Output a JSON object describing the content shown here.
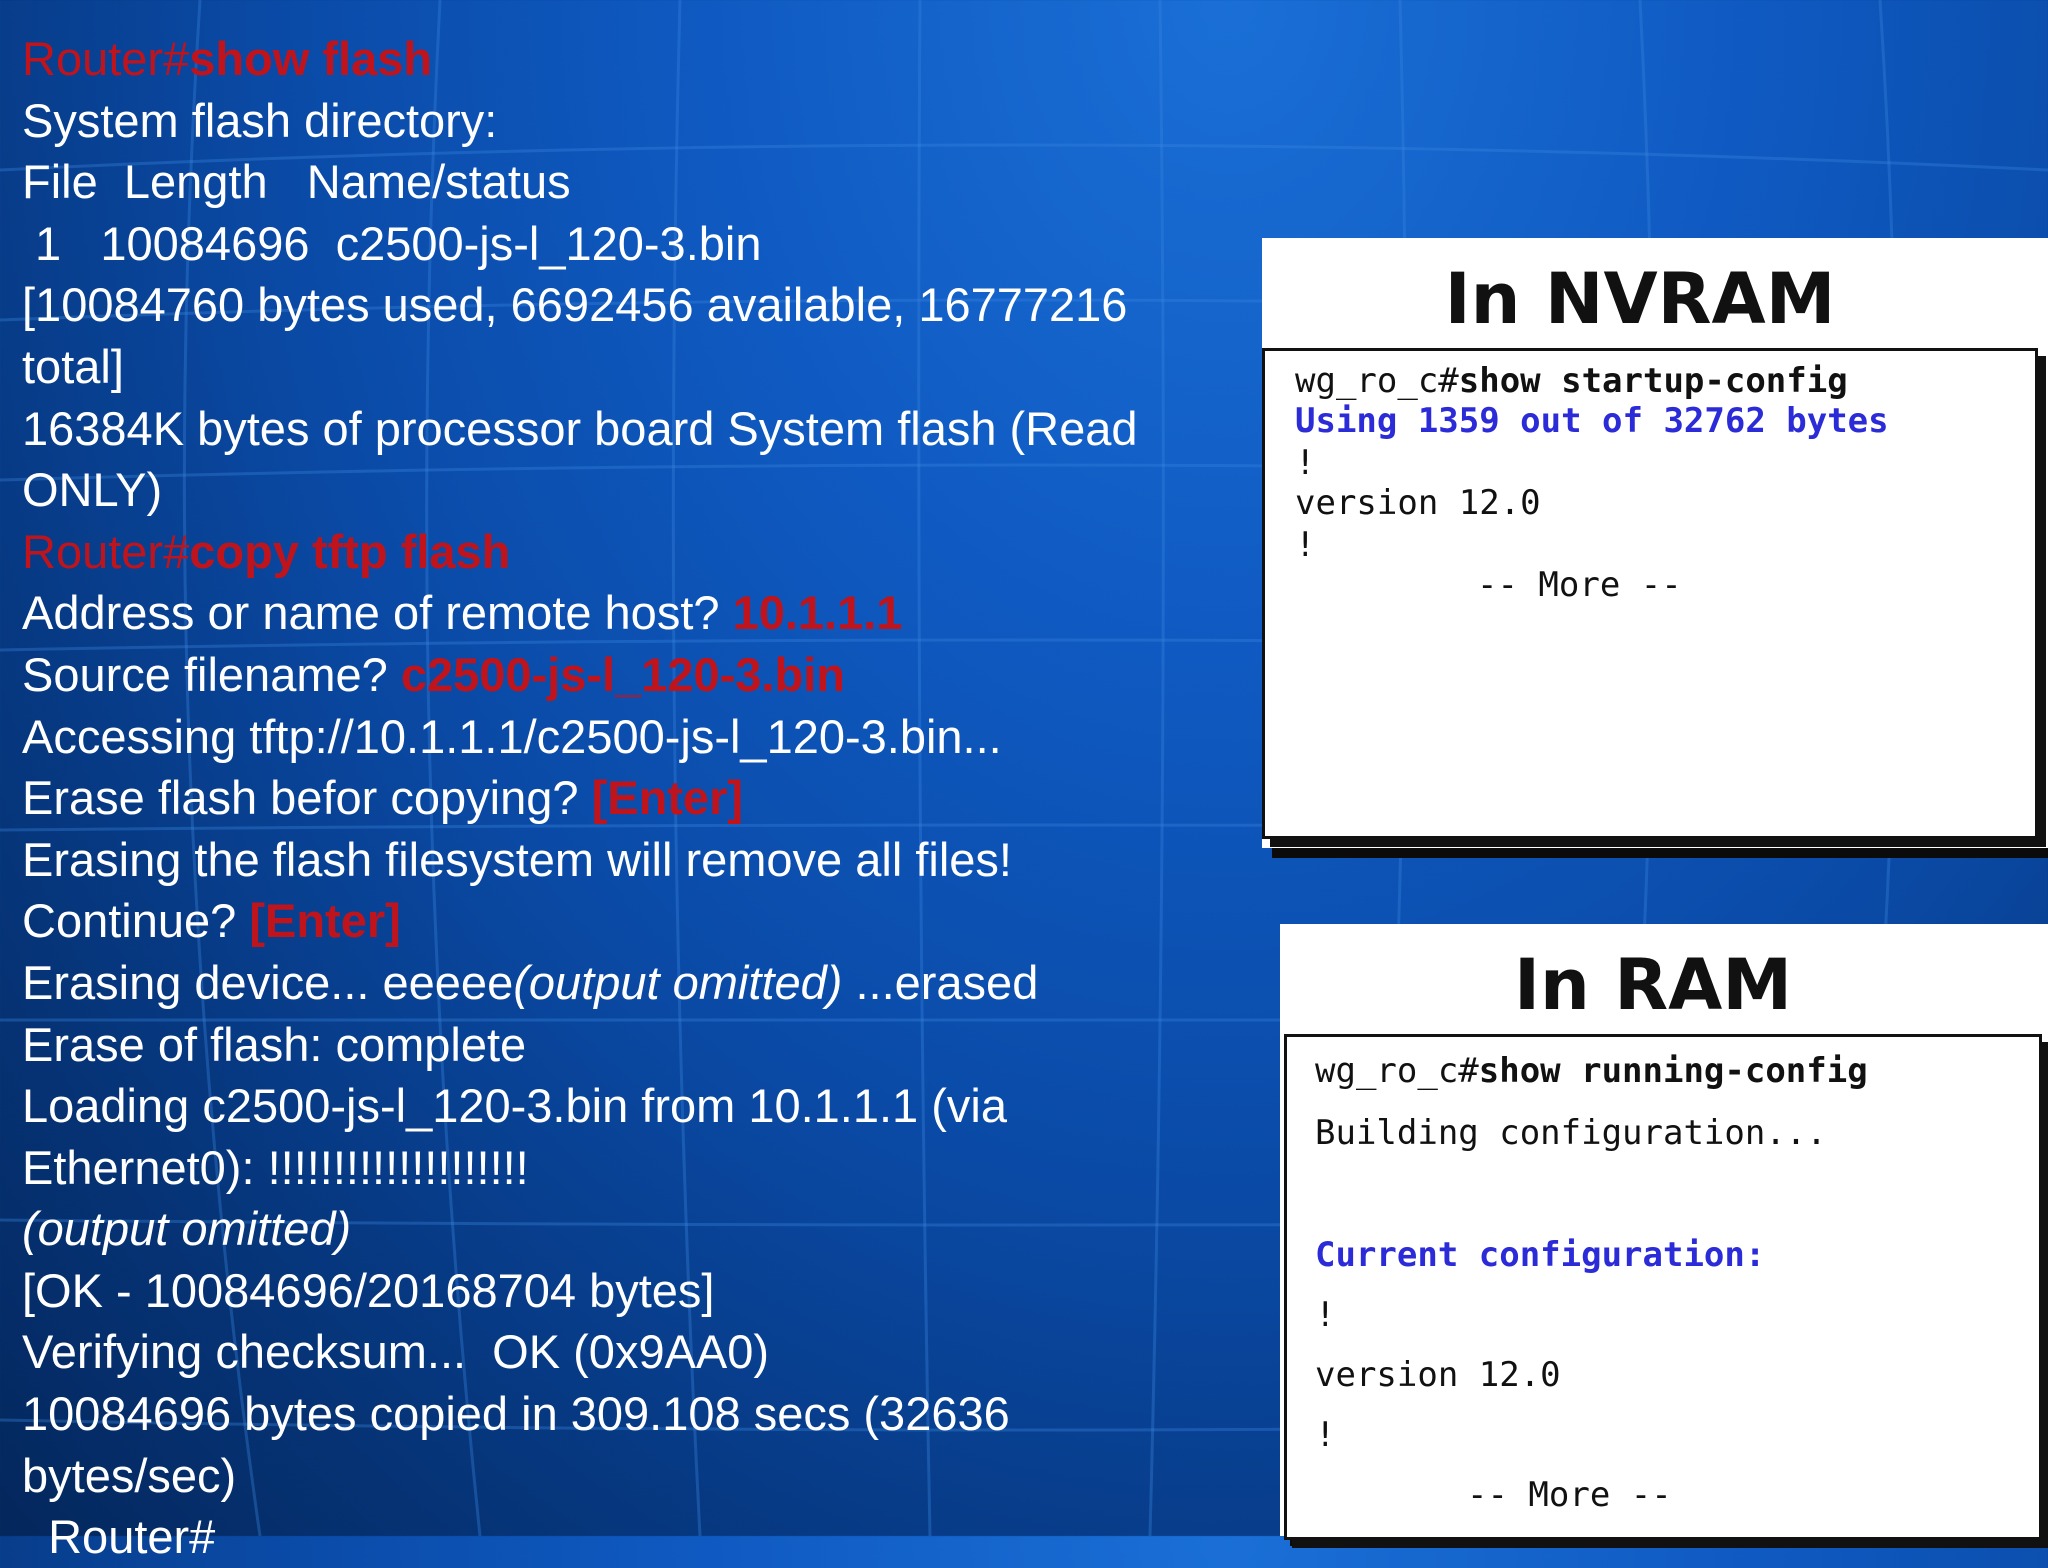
{
  "left": {
    "prompt1": "Router#",
    "cmd1": "show flash",
    "l_sysdir": "System flash directory:",
    "l_header": "File  Length   Name/status",
    "l_file": " 1   10084696  c2500-js-l_120-3.bin",
    "l_used": "[10084760 bytes used, 6692456 available, 16777216",
    "l_total": "total]",
    "l_proc": "16384K bytes of processor board System flash (Read",
    "l_only": "ONLY)",
    "prompt2": "Router#",
    "cmd2": "copy tftp flash",
    "l_addr": "Address or name of remote host? ",
    "v_addr": "10.1.1.1",
    "l_src": "Source filename? ",
    "v_src": "c2500-js-l_120-3.bin",
    "l_access": "Accessing tftp://10.1.1.1/c2500-js-l_120-3.bin...",
    "l_erase_q": "Erase flash befor copying? ",
    "v_enter1": "[Enter]",
    "l_erasing_fs": "Erasing the flash filesystem will remove all files!",
    "l_continue": "Continue? ",
    "v_enter2": "[Enter]",
    "l_erasing_dev_a": "Erasing device... eeeee",
    "l_erasing_dev_it": "(output omitted)",
    "l_erasing_dev_b": " ...erased",
    "l_erase_done": "Erase of flash: complete",
    "l_loading": "Loading c2500-js-l_120-3.bin from 10.1.1.1 (via",
    "l_eth": "Ethernet0): !!!!!!!!!!!!!!!!!!!!",
    "l_omitted": "(output omitted)",
    "l_ok": "[OK - 10084696/20168704 bytes]",
    "l_verify": "Verifying checksum...  OK (0x9AA0)",
    "l_copied": "10084696 bytes copied in 309.108 secs (32636",
    "l_rate": "bytes/sec)",
    "l_final": "  Router#"
  },
  "nvram": {
    "title": "In NVRAM",
    "prompt": "wg_ro_c#",
    "cmd": "show startup-config",
    "using": "Using 1359 out of 32762 bytes",
    "bang1": "!",
    "version": "version 12.0",
    "bang2": "!",
    "more": "-- More --"
  },
  "ram": {
    "title": "In RAM",
    "prompt": "wg_ro_c#",
    "cmd": "show running-config",
    "building": "Building configuration...",
    "current": "Current configuration:",
    "bang1": "!",
    "version": "version 12.0",
    "bang2": "!",
    "more": "-- More --"
  },
  "colors": {
    "accent_red": "#c0141c",
    "accent_blue": "#2b2bd8",
    "background": "#0a4aa6"
  }
}
